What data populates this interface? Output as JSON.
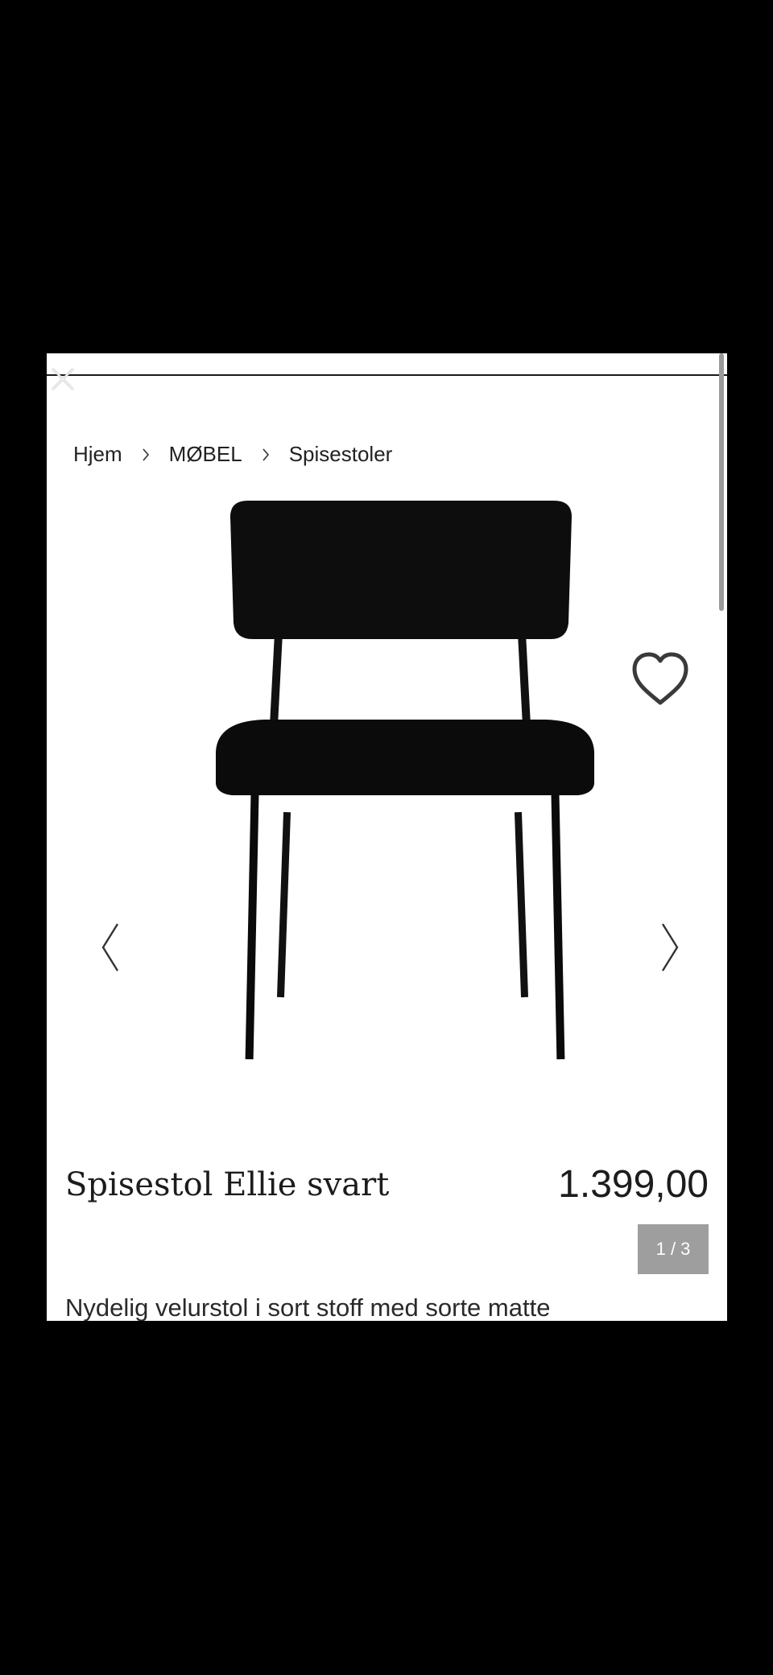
{
  "breadcrumb": {
    "items": [
      "Hjem",
      "MØBEL",
      "Spisestoler"
    ]
  },
  "gallery": {
    "counter": "1 / 3",
    "image_subject": "black velvet dining chair with black metal legs"
  },
  "product": {
    "title": "Spisestol Ellie svart",
    "price": "1.399,00",
    "description": "Nydelig velurstol i sort stoff med sorte matte"
  },
  "icons": {
    "close": "close-icon",
    "favorite": "heart-outline-icon",
    "prev": "chevron-left-icon",
    "next": "chevron-right-icon",
    "separator": "chevron-right-small-icon"
  },
  "colors": {
    "background": "#000000",
    "card": "#ffffff",
    "text": "#1c1c1c",
    "counter_bg": "#9e9e9e"
  }
}
